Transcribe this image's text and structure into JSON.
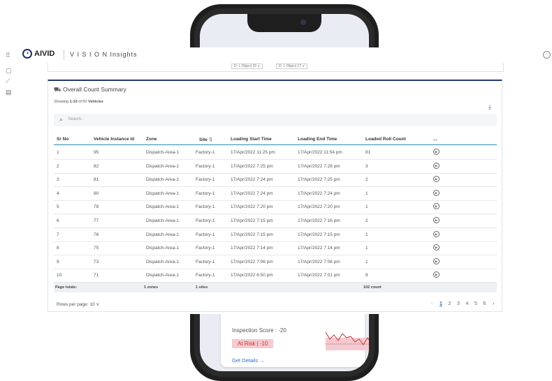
{
  "app": {
    "logo_text": "AIVID",
    "title": "V I S I O N Insights"
  },
  "phone_card": {
    "inspection_score": "Inspection Score : -20",
    "risk_badge": "At Risk | -10",
    "get_details": "Get Details →"
  },
  "filters": [
    "D- L Object 15 ∨",
    "D- L Object 17 ∨"
  ],
  "summary": {
    "title": "Overall Count Summary",
    "showing_prefix": "Showing ",
    "showing_range": "1-10",
    "showing_mid": " of 60 ",
    "showing_entity": "Vehicles",
    "search_placeholder": "Search.."
  },
  "table": {
    "headers": {
      "sr_no": "Sr No",
      "vehicle_id": "Vehicle Instance Id",
      "zone": "Zone",
      "site": "Site",
      "start": "Loading Start Time",
      "end": "Loading End Time",
      "count": "Loaded Roll Count",
      "actions": "..."
    },
    "rows": [
      {
        "sr": "1",
        "vid": "95",
        "zone": "Dispatch-Area-1",
        "site": "Factory-1",
        "start": "17/Apr/2022 11:25 pm",
        "end": "17/Apr/2022 11:54 pm",
        "count": "81"
      },
      {
        "sr": "2",
        "vid": "82",
        "zone": "Dispatch-Area-1",
        "site": "Factory-1",
        "start": "17/Apr/2022 7:25 pm",
        "end": "17/Apr/2022 7:28 pm",
        "count": "3"
      },
      {
        "sr": "3",
        "vid": "81",
        "zone": "Dispatch-Area-1",
        "site": "Factory-1",
        "start": "17/Apr/2022 7:24 pm",
        "end": "17/Apr/2022 7:25 pm",
        "count": "2"
      },
      {
        "sr": "4",
        "vid": "80",
        "zone": "Dispatch-Area-1",
        "site": "Factory-1",
        "start": "17/Apr/2022 7:24 pm",
        "end": "17/Apr/2022 7:24 pm",
        "count": "1"
      },
      {
        "sr": "5",
        "vid": "78",
        "zone": "Dispatch-Area-1",
        "site": "Factory-1",
        "start": "17/Apr/2022 7:20 pm",
        "end": "17/Apr/2022 7:20 pm",
        "count": "1"
      },
      {
        "sr": "6",
        "vid": "77",
        "zone": "Dispatch-Area-1",
        "site": "Factory-1",
        "start": "17/Apr/2022 7:15 pm",
        "end": "17/Apr/2022 7:16 pm",
        "count": "2"
      },
      {
        "sr": "7",
        "vid": "76",
        "zone": "Dispatch-Area-1",
        "site": "Factory-1",
        "start": "17/Apr/2022 7:15 pm",
        "end": "17/Apr/2022 7:15 pm",
        "count": "1"
      },
      {
        "sr": "8",
        "vid": "75",
        "zone": "Dispatch-Area-1",
        "site": "Factory-1",
        "start": "17/Apr/2022 7:14 pm",
        "end": "17/Apr/2022 7:14 pm",
        "count": "1"
      },
      {
        "sr": "9",
        "vid": "73",
        "zone": "Dispatch-Area-1",
        "site": "Factory-1",
        "start": "17/Apr/2022 7:06 pm",
        "end": "17/Apr/2022 7:06 pm",
        "count": "1"
      },
      {
        "sr": "10",
        "vid": "71",
        "zone": "Dispatch-Area-1",
        "site": "Factory-1",
        "start": "17/Apr/2022 6:50 pm",
        "end": "17/Apr/2022 7:01 pm",
        "count": "9"
      }
    ],
    "totals": {
      "label": "Page totals:",
      "zones": "1 zones",
      "sites": "1 sites",
      "count": "102 count"
    }
  },
  "pagination": {
    "rows_per_page": "Rows per page: 10 ∨",
    "prev": "‹",
    "pages": [
      "1",
      "2",
      "3",
      "4",
      "5",
      "6"
    ],
    "next": "›",
    "current": "1"
  },
  "colors": {
    "accent": "#1f3a6b",
    "link": "#2b6cc4",
    "risk_bg": "#f6c9d0"
  },
  "icons": [
    "grid-icon",
    "clipboard-icon",
    "chart-icon",
    "report-icon",
    "truck-icon",
    "download-icon",
    "search-icon",
    "play-icon",
    "user-icon"
  ]
}
